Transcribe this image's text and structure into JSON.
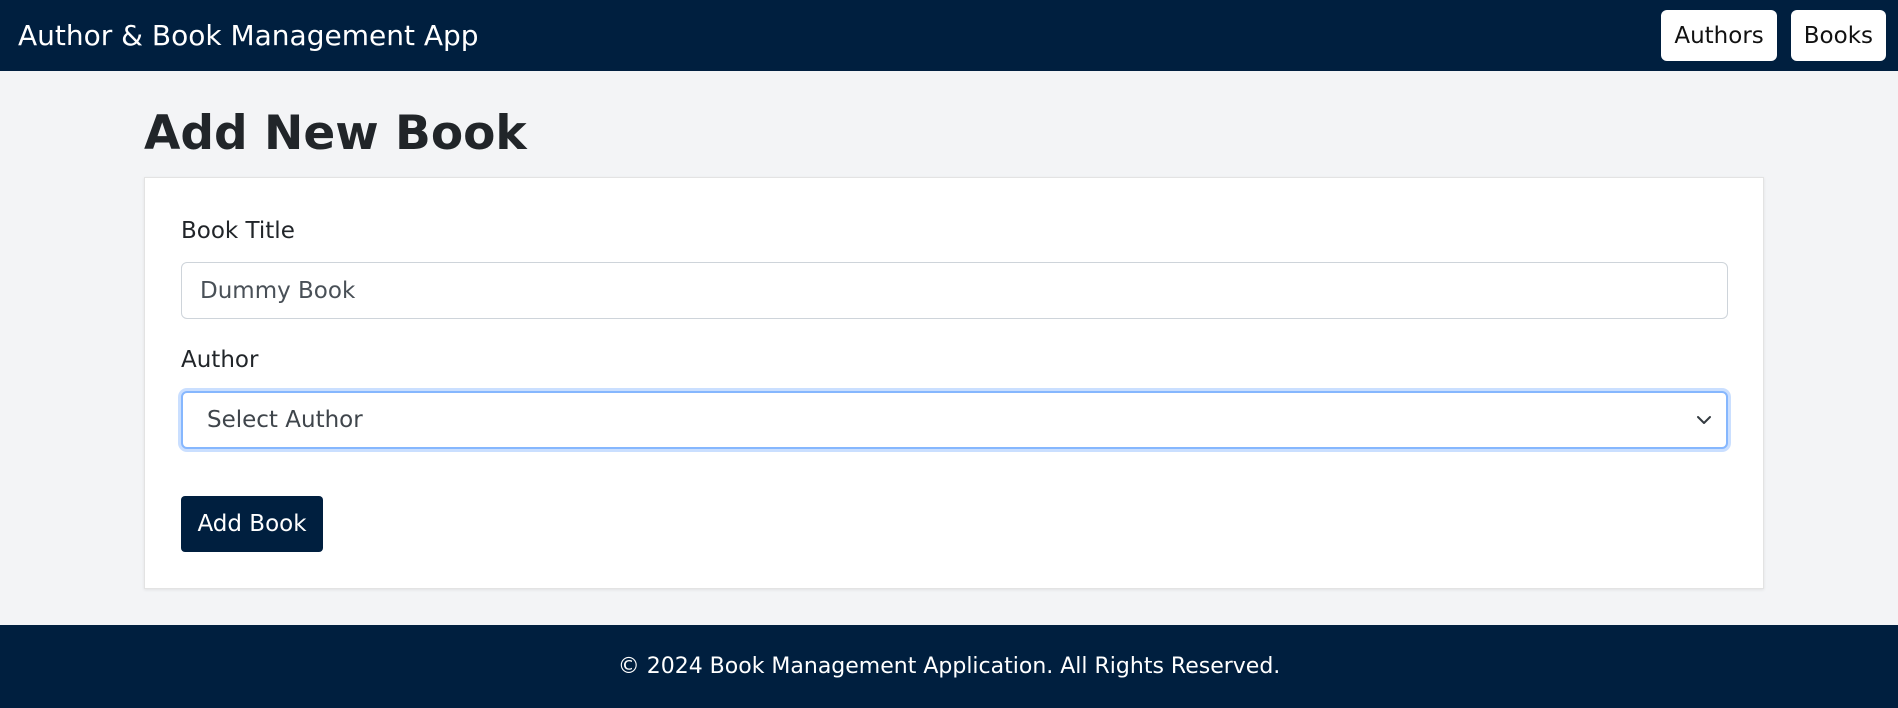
{
  "navbar": {
    "brand": "Author & Book Management App",
    "links": [
      {
        "label": "Authors"
      },
      {
        "label": "Books"
      }
    ]
  },
  "page": {
    "title": "Add New Book"
  },
  "form": {
    "title_label": "Book Title",
    "title_value": "Dummy Book",
    "author_label": "Author",
    "author_selected": "Select Author",
    "submit_label": "Add Book"
  },
  "footer": {
    "text": "© 2024 Book Management Application. All Rights Reserved."
  },
  "icons": {
    "select_arrow": "chevron-down-icon"
  },
  "colors": {
    "primary": "#001f3f",
    "background": "#f3f4f6",
    "focus": "#86b7fe"
  }
}
